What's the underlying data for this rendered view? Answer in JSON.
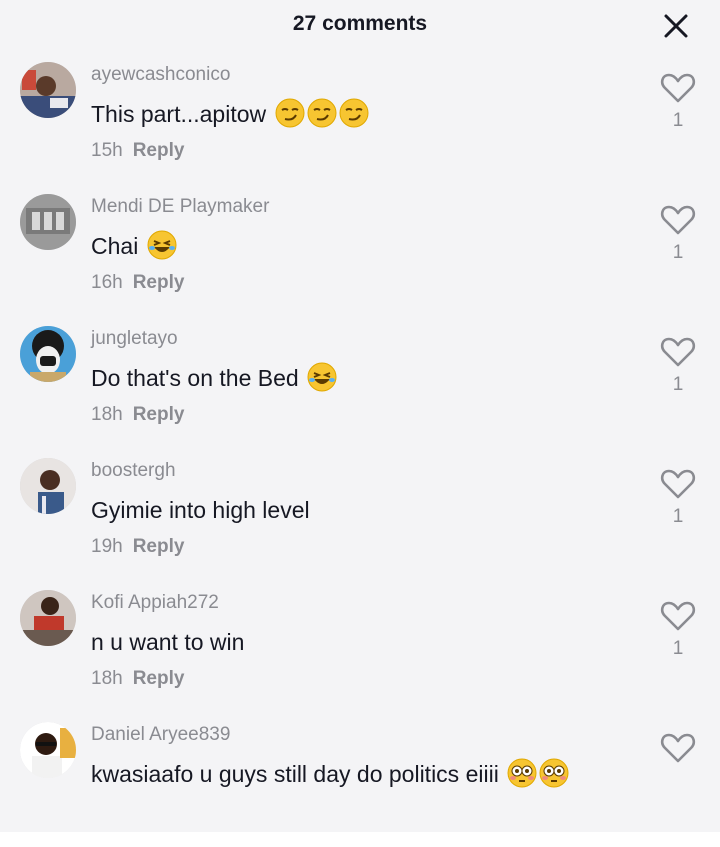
{
  "header": {
    "title": "27 comments",
    "close_icon": "close-icon"
  },
  "comments": [
    {
      "username": "ayewcashconico",
      "text": "This part...apitow",
      "emojis": [
        "smirk",
        "smirk",
        "smirk"
      ],
      "time": "15h",
      "reply": "Reply",
      "likes": "1"
    },
    {
      "username": "Mendi DE Playmaker",
      "text": "Chai",
      "emojis": [
        "joy"
      ],
      "time": "16h",
      "reply": "Reply",
      "likes": "1"
    },
    {
      "username": "jungletayo",
      "text": "Do that's on the Bed",
      "emojis": [
        "joy"
      ],
      "time": "18h",
      "reply": "Reply",
      "likes": "1"
    },
    {
      "username": "boostergh",
      "text": "Gyimie into high level",
      "emojis": [],
      "time": "19h",
      "reply": "Reply",
      "likes": "1"
    },
    {
      "username": "Kofi Appiah272",
      "text": "n u want to win",
      "emojis": [],
      "time": "18h",
      "reply": "Reply",
      "likes": "1"
    },
    {
      "username": "Daniel Aryee839",
      "text": "kwasiaafo u guys still day do politics eiiii",
      "emojis": [
        "flushed",
        "flushed"
      ],
      "time": "",
      "reply": "",
      "likes": ""
    }
  ],
  "colors": {
    "background": "#f4f4f6",
    "primary_text": "#161823",
    "secondary_text": "#8a8b91"
  }
}
